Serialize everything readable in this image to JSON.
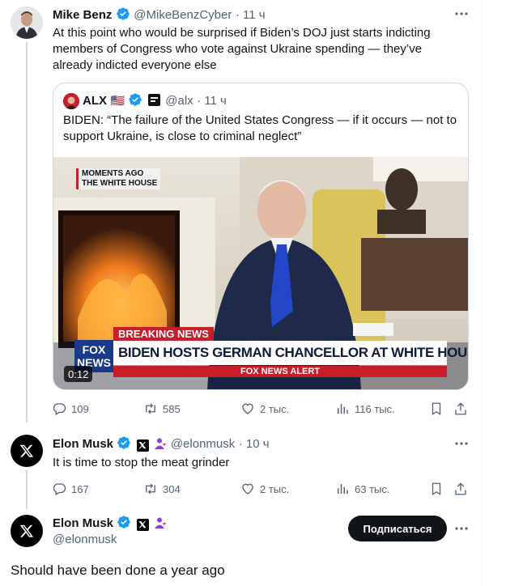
{
  "tweet1": {
    "name": "Mike Benz",
    "handle": "@MikeBenzCyber",
    "time": "· 11 ч",
    "text": "At this point who would be surprised if Biden’s DOJ just starts indicting members of Congress who vote against Ukraine spending — they’ve already indicted everyone else",
    "replies": "109",
    "retweets": "585",
    "likes": "2 тыс.",
    "views": "116 тыс."
  },
  "quote": {
    "name": "ALX",
    "flag": "🇺🇸",
    "handle": "@alx",
    "time": "· 11 ч",
    "text": "BIDEN: “The failure of the United States Congress — if it occurs — not to support Ukraine, is close to criminal neglect”",
    "video": {
      "duration": "0:12",
      "tag_line1": "MOMENTS AGO",
      "tag_line2": "THE WHITE HOUSE",
      "breaking": "BREAKING NEWS",
      "headline": "BIDEN HOSTS GERMAN CHANCELLOR AT WHITE HOUSE",
      "logo": "FOX NEWS",
      "alert": "FOX NEWS ALERT"
    }
  },
  "tweet2": {
    "name": "Elon Musk",
    "handle": "@elonmusk",
    "time": "· 10 ч",
    "text": "It is time to stop the meat grinder",
    "replies": "167",
    "retweets": "304",
    "likes": "2 тыс.",
    "views": "63 тыс."
  },
  "tweet3": {
    "name": "Elon Musk",
    "handle": "@elonmusk",
    "follow_label": "Подписаться",
    "text": "Should have been done a year ago"
  },
  "colors": {
    "verified": "#1d9bf0",
    "muted": "#536471",
    "fox_red": "#d0202a",
    "fox_blue": "#1a3a8a"
  }
}
